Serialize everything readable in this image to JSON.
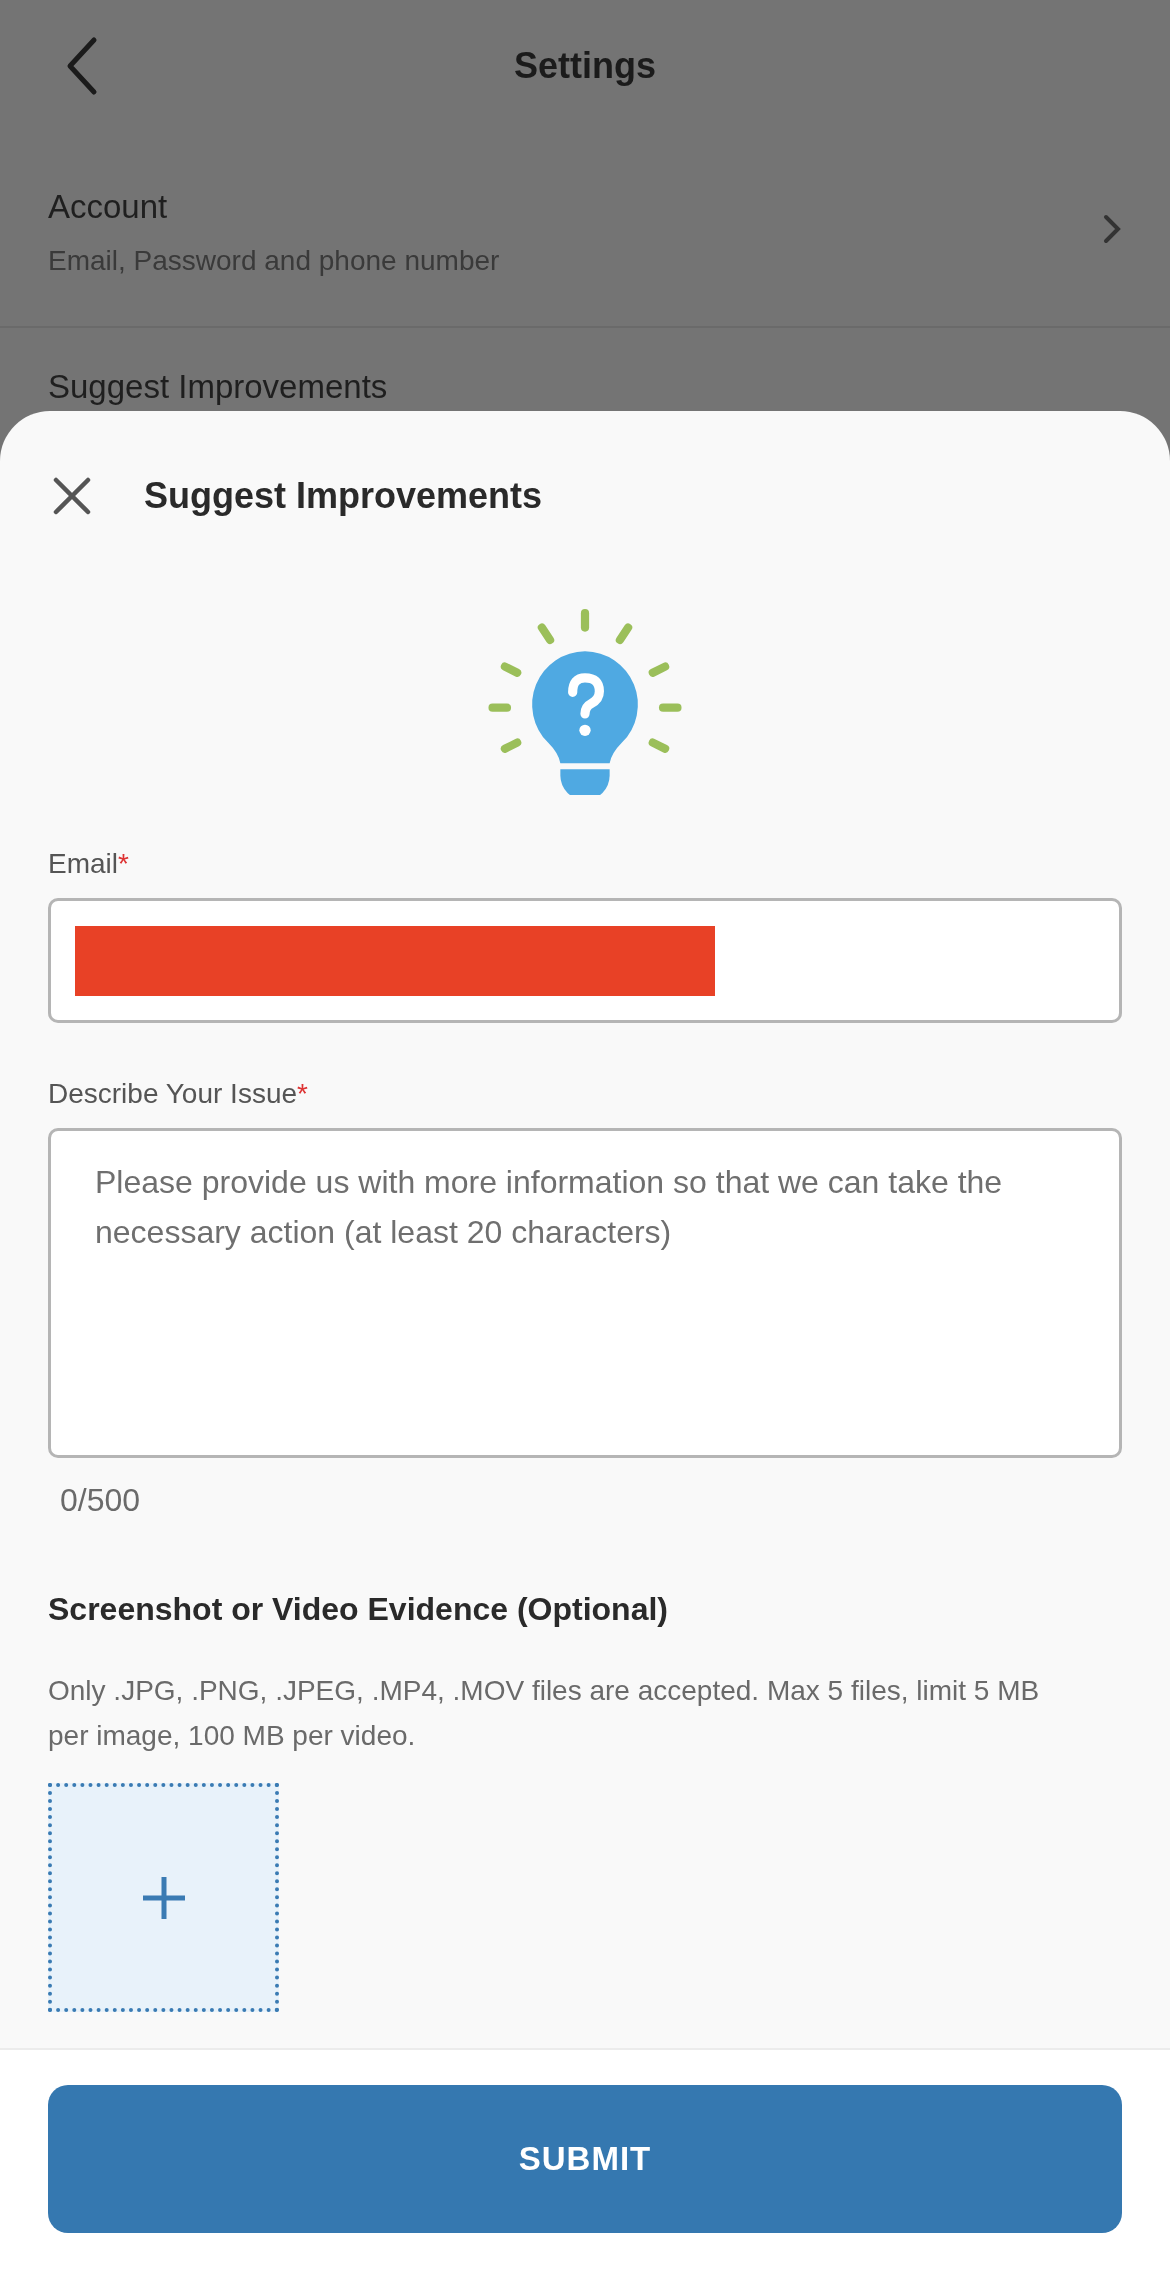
{
  "header": {
    "title": "Settings"
  },
  "settings_items": [
    {
      "title": "Account",
      "subtitle": "Email, Password and phone number"
    },
    {
      "title": "Suggest Improvements"
    }
  ],
  "sheet": {
    "title": "Suggest Improvements",
    "email": {
      "label": "Email",
      "required_mark": "*"
    },
    "description": {
      "label": "Describe Your Issue",
      "required_mark": "*",
      "placeholder": "Please provide us with more information so that we can take the necessary action (at least 20 characters)",
      "counter": "0/500"
    },
    "evidence": {
      "heading": "Screenshot or Video Evidence (Optional)",
      "note": "Only .JPG, .PNG, .JPEG, .MP4, .MOV files are accepted. Max 5 files, limit 5 MB per image, 100 MB per video."
    },
    "submit": "SUBMIT"
  }
}
